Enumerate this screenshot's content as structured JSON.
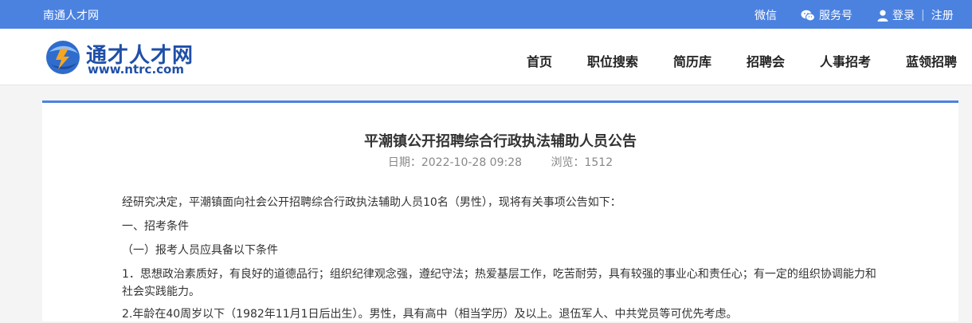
{
  "topbar": {
    "site_name": "南通人才网",
    "wechat_label": "微信",
    "service_label": "服务号",
    "login_label": "登录",
    "register_label": "注册",
    "bg_color": "#4b82e0"
  },
  "header": {
    "logo_cn": "通才人才网",
    "logo_en": "www.ntrc.com",
    "nav": [
      "首页",
      "职位搜索",
      "简历库",
      "招聘会",
      "人事招考",
      "蓝领招聘"
    ]
  },
  "article": {
    "title": "平潮镇公开招聘综合行政执法辅助人员公告",
    "date": "日期：2022-10-28 09:28",
    "views": "浏览：1512",
    "paragraphs": [
      "经研究决定，平潮镇面向社会公开招聘综合行政执法辅助人员10名（男性），现将有关事项公告如下：",
      "一、招考条件",
      "（一）报考人员应具备以下条件",
      "1．思想政治素质好，有良好的道德品行；组织纪律观念强，遵纪守法；热爱基层工作，吃苦耐劳，具有较强的事业心和责任心；有一定的组织协调能力和社会实践能力。",
      "2.年龄在40周岁以下（1982年11月1日后出生）。男性，具有高中（相当学历）及以上。退伍军人、中共党员等可优先考虑。"
    ]
  }
}
